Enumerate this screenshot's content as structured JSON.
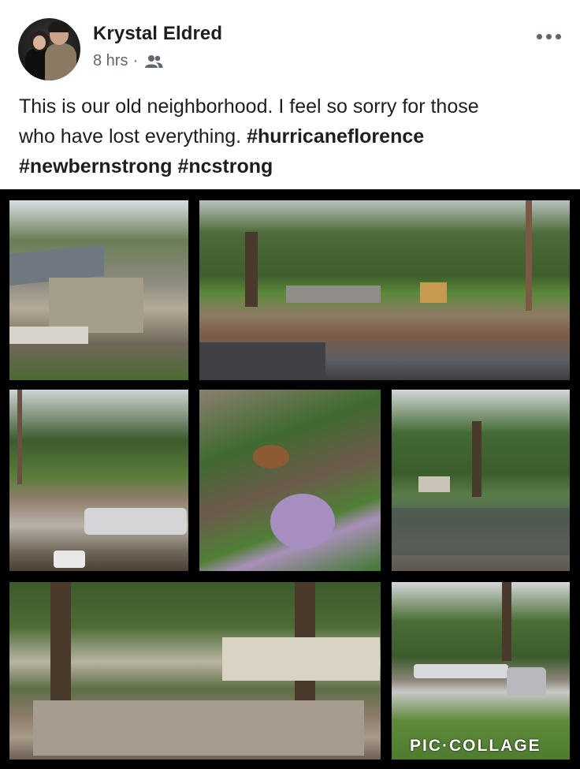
{
  "post": {
    "author": "Krystal Eldred",
    "time": "8 hrs",
    "separator": "·",
    "audience_icon": "friends-icon",
    "more_icon": "more-options-icon",
    "text_line1": "This is our old neighborhood. I feel so sorry for those",
    "text_line2_plain": "who have lost everything. ",
    "hashtags": [
      "#hurricaneflorence",
      "#newbernstrong",
      "#ncstrong"
    ]
  },
  "collage": {
    "watermark": "PIC·COLLAGE",
    "photos": [
      {
        "name": "collage-photo-1"
      },
      {
        "name": "collage-photo-2"
      },
      {
        "name": "collage-photo-3"
      },
      {
        "name": "collage-photo-4"
      },
      {
        "name": "collage-photo-5"
      },
      {
        "name": "collage-photo-6"
      },
      {
        "name": "collage-photo-7"
      }
    ]
  },
  "colors": {
    "text_primary": "#1c1e21",
    "text_secondary": "#606770",
    "collage_background": "#000000"
  }
}
